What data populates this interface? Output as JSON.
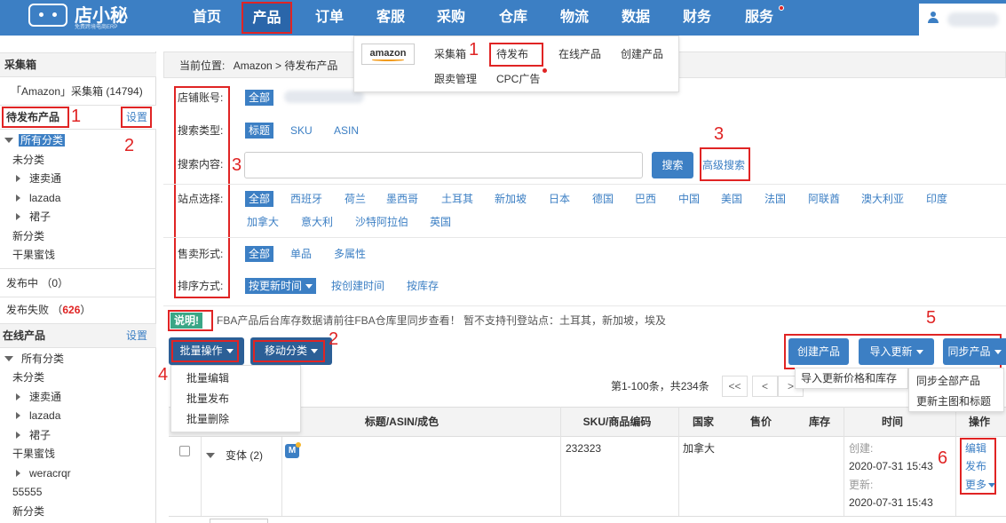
{
  "topbar": {
    "logo_title": "店小秘",
    "logo_subtitle": "免费跨境电商ERP",
    "nav": [
      "首页",
      "产品",
      "订单",
      "客服",
      "采购",
      "仓库",
      "物流",
      "数据",
      "财务",
      "服务"
    ],
    "active_nav": "产品"
  },
  "product_menu": {
    "platform_logo": "amazon",
    "items_row1": [
      "采集箱",
      "待发布",
      "在线产品",
      "创建产品"
    ],
    "items_row2": [
      "跟卖管理",
      "CPC广告"
    ]
  },
  "sidebar": {
    "collect_box_title": "采集箱",
    "amazon_collect": "「Amazon」采集箱 (14794)",
    "pending_title": "待发布产品",
    "settings_label": "设置",
    "pending_tree": {
      "all": "所有分类",
      "items": [
        "未分类",
        "速卖通",
        "lazada",
        "裙子",
        "新分类",
        "干果蜜饯"
      ]
    },
    "publishing": "发布中 （0）",
    "failed_label": "发布失败 （",
    "failed_count": "626",
    "failed_close": "）",
    "online_title": "在线产品",
    "online_settings": "设置",
    "online_tree": {
      "all": "所有分类",
      "items": [
        "未分类",
        "速卖通",
        "lazada",
        "裙子",
        "干果蜜饯",
        "weracrqr",
        "55555",
        "新分类"
      ]
    }
  },
  "breadcrumb": {
    "label": "当前位置:",
    "path": "Amazon > 待发布产品"
  },
  "filters": {
    "shop_label": "店铺账号:",
    "shop_all": "全部",
    "search_type_label": "搜索类型:",
    "search_types": [
      "标题",
      "SKU",
      "ASIN"
    ],
    "search_content_label": "搜索内容:",
    "search_placeholder": "",
    "search_button": "搜索",
    "advanced_search": "高级搜索",
    "site_label": "站点选择:",
    "sites_row1": [
      "全部",
      "西班牙",
      "荷兰",
      "墨西哥",
      "土耳其",
      "新加坡",
      "日本",
      "德国",
      "巴西",
      "中国",
      "美国",
      "法国",
      "阿联酋",
      "澳大利亚",
      "印度"
    ],
    "sites_row2": [
      "加拿大",
      "意大利",
      "沙特阿拉伯",
      "英国"
    ],
    "sale_type_label": "售卖形式:",
    "sale_types": [
      "全部",
      "单品",
      "多属性"
    ],
    "sort_label": "排序方式:",
    "sort_options": [
      "按更新时间",
      "按创建时间",
      "按库存"
    ]
  },
  "notice": {
    "badge": "说明!",
    "text": "FBA产品后台库存数据请前往FBA仓库里同步查看！ 暂不支持刊登站点：土耳其，新加坡，埃及"
  },
  "actions": {
    "batch_ops": "批量操作",
    "move_category": "移动分类",
    "batch_menu": [
      "批量编辑",
      "批量发布",
      "批量删除"
    ],
    "create_product": "创建产品",
    "import_update": "导入更新",
    "import_menu": [
      "导入更新价格和库存"
    ],
    "sync_product": "同步产品",
    "sync_menu": [
      "同步全部产品",
      "更新主图和标题"
    ]
  },
  "pagination": {
    "summary": "第1-100条，共234条",
    "buttons": [
      "<<",
      "<",
      ">"
    ]
  },
  "table": {
    "headers": [
      "标题/ASIN/成色",
      "SKU/商品编码",
      "国家",
      "售价",
      "库存",
      "时间",
      "操作"
    ],
    "rows": [
      {
        "variant": "变体 (2)",
        "sku": "232323",
        "country": "加拿大",
        "created_label": "创建:",
        "created": "2020-07-31 15:43",
        "updated_label": "更新:",
        "updated": "2020-07-31 15:43",
        "ops": [
          "编辑",
          "发布",
          "更多"
        ]
      }
    ]
  },
  "annotations": {
    "markers": [
      "1",
      "1",
      "2",
      "2",
      "3",
      "3",
      "4",
      "5",
      "6"
    ]
  },
  "colors": {
    "primary": "#3c7fc4",
    "annotation_red": "#e02424",
    "notice_green": "#3aa686"
  }
}
